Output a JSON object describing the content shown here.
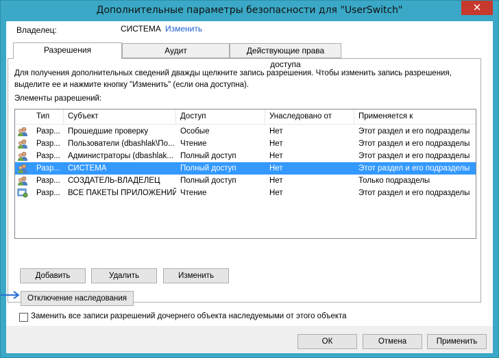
{
  "window": {
    "title": "Дополнительные параметры безопасности  для \"UserSwitch\"",
    "close_glyph": "✕"
  },
  "owner": {
    "label": "Владелец:",
    "value": "СИСТЕМА",
    "change_link": "Изменить"
  },
  "tabs": [
    {
      "label": "Разрешения",
      "active": true
    },
    {
      "label": "Аудит",
      "active": false
    },
    {
      "label": "Действующие права доступа",
      "active": false
    }
  ],
  "info_text": "Для получения дополнительных сведений дважды щелкните запись разрешения. Чтобы изменить запись разрешения, выделите ее и нажмите кнопку \"Изменить\" (если она доступна).",
  "elements_label": "Элементы разрешений:",
  "table": {
    "columns": [
      "Тип",
      "Субъект",
      "Доступ",
      "Унаследовано от",
      "Применяется к"
    ],
    "rows": [
      {
        "type": "Разр...",
        "subject": "Прошедшие проверку",
        "access": "Особые",
        "inherited": "Нет",
        "applies": "Этот раздел и его подразделы",
        "icon": "users-icon",
        "selected": false
      },
      {
        "type": "Разр...",
        "subject": "Пользователи (dbashlak\\По...",
        "access": "Чтение",
        "inherited": "Нет",
        "applies": "Этот раздел и его подразделы",
        "icon": "users-icon",
        "selected": false
      },
      {
        "type": "Разр...",
        "subject": "Администраторы (dbashlak...",
        "access": "Полный доступ",
        "inherited": "Нет",
        "applies": "Этот раздел и его подразделы",
        "icon": "users-icon",
        "selected": false
      },
      {
        "type": "Разр...",
        "subject": "СИСТЕМА",
        "access": "Полный доступ",
        "inherited": "Нет",
        "applies": "Этот раздел и его подразделы",
        "icon": "users-icon",
        "selected": true
      },
      {
        "type": "Разр...",
        "subject": "СОЗДАТЕЛЬ-ВЛАДЕЛЕЦ",
        "access": "Полный доступ",
        "inherited": "Нет",
        "applies": "Только подразделы",
        "icon": "users-icon",
        "selected": false
      },
      {
        "type": "Разр...",
        "subject": "ВСЕ ПАКЕТЫ ПРИЛОЖЕНИЙ",
        "access": "Чтение",
        "inherited": "Нет",
        "applies": "Этот раздел и его подразделы",
        "icon": "app-packages-icon",
        "selected": false
      }
    ]
  },
  "buttons": {
    "add": "Добавить",
    "remove": "Удалить",
    "edit": "Изменить",
    "disable_inheritance": "Отключение наследования",
    "ok": "ОК",
    "cancel": "Отмена",
    "apply": "Применить"
  },
  "replace_checkbox": {
    "label": "Заменить все записи разрешений дочернего объекта наследуемыми от этого объекта",
    "checked": false
  },
  "colors": {
    "title_bar": "#3aa8c6",
    "selection": "#3399ff",
    "close_button": "#c7392c",
    "link": "#1f5fd1",
    "arrow": "#2a6fd6"
  }
}
